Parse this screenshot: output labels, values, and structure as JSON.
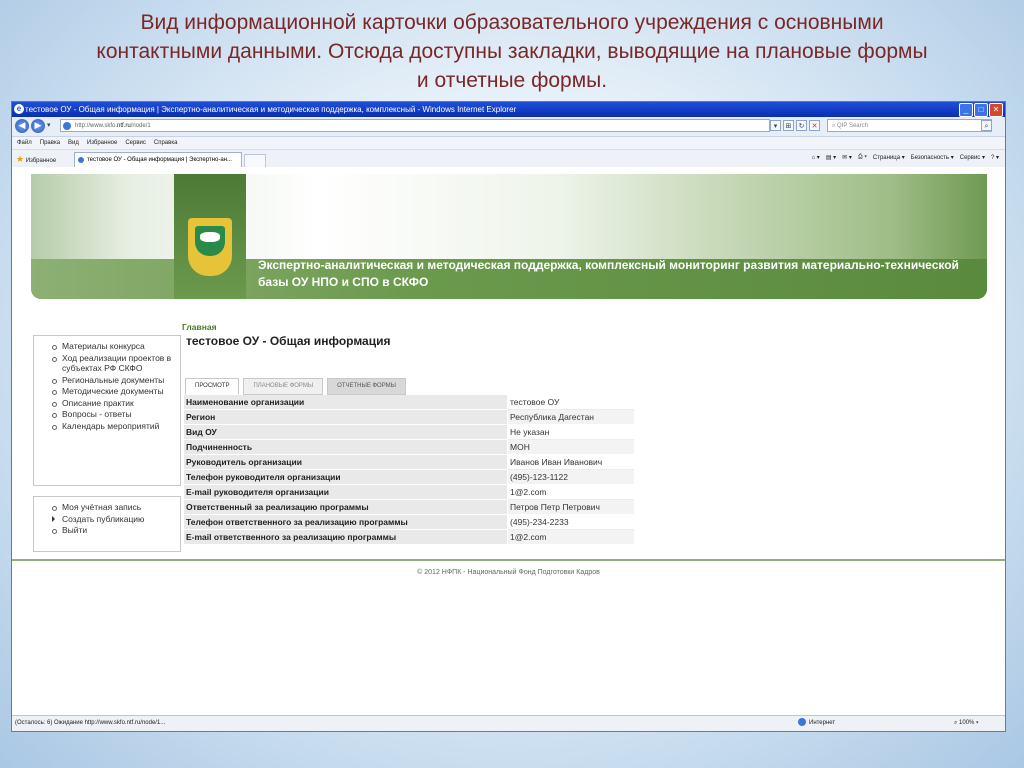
{
  "caption": {
    "line1": "Вид информационной карточки образовательного учреждения с основными",
    "line2": "контактными данными. Отсюда доступны закладки, выводящие на плановые формы",
    "line3": "и отчетные формы."
  },
  "browser": {
    "window_title": "тестовое ОУ - Общая информация | Экспертно-аналитическая и методическая поддержка, комплексный - Windows Internet Explorer",
    "address_prefix": "http://www.skfo.",
    "address_host": "ntf.ru",
    "address_suffix": "/node/1",
    "search_placeholder": "QIP Search",
    "menu": [
      "Файл",
      "Правка",
      "Вид",
      "Избранное",
      "Сервис",
      "Справка"
    ],
    "favorites_label": "Избранное",
    "tab_label": "тестовое ОУ - Общая информация | Экспертно-ан...",
    "command_bar": {
      "page": "Страница",
      "safety": "Безопасность",
      "tools": "Сервис"
    },
    "status": {
      "left": "(Осталось: 6) Ожидание http://www.skfo.ntf.ru/node/1...",
      "zone": "Интернет",
      "zoom": "100%"
    }
  },
  "site": {
    "banner_text": "Экспертно-аналитическая и методическая поддержка, комплексный мониторинг развития материально-технической базы ОУ НПО и СПО в СКФО",
    "sidebar_menu": [
      "Материалы конкурса",
      "Ход реализации проектов в субъектах РФ СКФО",
      "Региональные документы",
      "Методические документы",
      "Описание практик",
      "Вопросы - ответы",
      "Календарь мероприятий"
    ],
    "user_menu": [
      "Моя учётная запись",
      "Создать публикацию",
      "Выйти"
    ],
    "breadcrumb": "Главная",
    "page_title": "тестовое ОУ - Общая информация",
    "tabs": [
      "ПРОСМОТР",
      "ПЛАНОВЫЕ ФОРМЫ",
      "ОТЧЕТНЫЕ ФОРМЫ"
    ],
    "info_rows": [
      {
        "label": "Наименование организации",
        "value": "тестовое ОУ"
      },
      {
        "label": "Регион",
        "value": "Республика Дагестан"
      },
      {
        "label": "Вид ОУ",
        "value": "Не указан"
      },
      {
        "label": "Подчиненность",
        "value": "МОН"
      },
      {
        "label": "Руководитель организации",
        "value": "Иванов Иван Иванович"
      },
      {
        "label": "Телефон руководителя организации",
        "value": "(495)-123-1122"
      },
      {
        "label": "E-mail руководителя организации",
        "value": "1@2.com"
      },
      {
        "label": "Ответственный за реализацию программы",
        "value": "Петров Петр Петрович"
      },
      {
        "label": "Телефон ответственного за реализацию программы",
        "value": "(495)-234-2233"
      },
      {
        "label": "E-mail ответственного за реализацию программы",
        "value": "1@2.com"
      }
    ],
    "footer": "© 2012 НФПК - Национальный Фонд Подготовки Кадров"
  }
}
